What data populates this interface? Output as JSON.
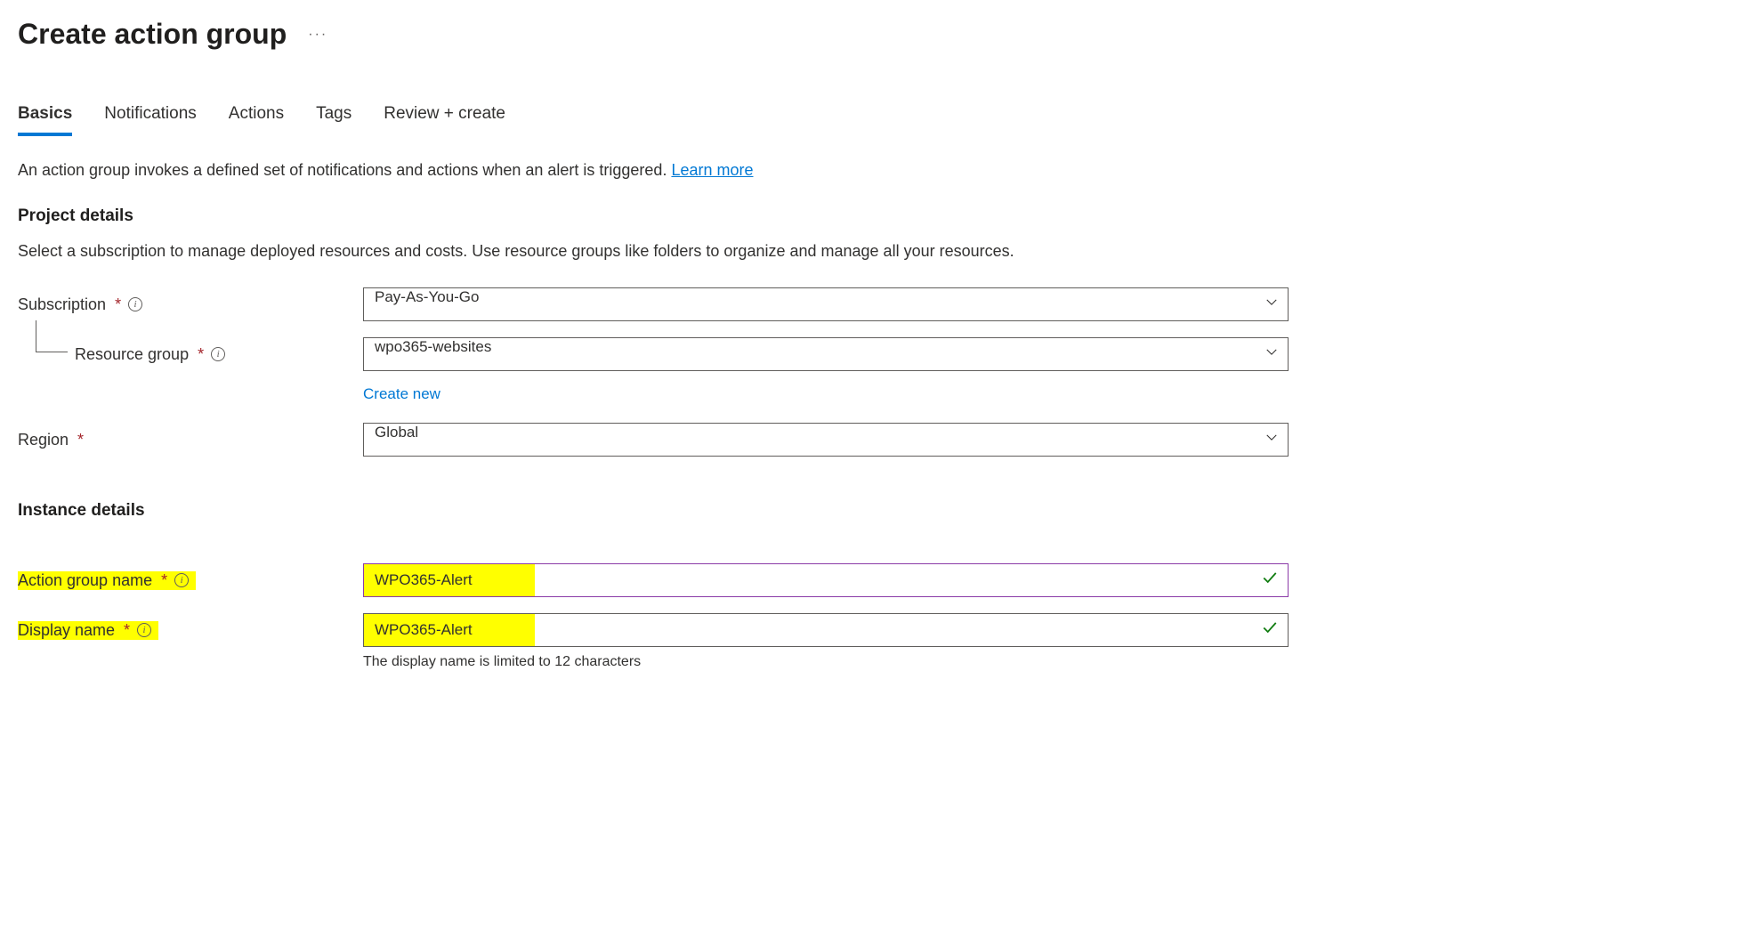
{
  "header": {
    "title": "Create action group"
  },
  "tabs": [
    {
      "label": "Basics",
      "active": true
    },
    {
      "label": "Notifications",
      "active": false
    },
    {
      "label": "Actions",
      "active": false
    },
    {
      "label": "Tags",
      "active": false
    },
    {
      "label": "Review + create",
      "active": false
    }
  ],
  "intro": {
    "text": "An action group invokes a defined set of notifications and actions when an alert is triggered. ",
    "link_text": "Learn more"
  },
  "project_details": {
    "title": "Project details",
    "desc": "Select a subscription to manage deployed resources and costs. Use resource groups like folders to organize and manage all your resources.",
    "subscription_label": "Subscription",
    "subscription_value": "Pay-As-You-Go",
    "resource_group_label": "Resource group",
    "resource_group_value": "wpo365-websites",
    "create_new": "Create new",
    "region_label": "Region",
    "region_value": "Global"
  },
  "instance_details": {
    "title": "Instance details",
    "action_group_label": "Action group name",
    "action_group_value": "WPO365-Alert",
    "display_name_label": "Display name",
    "display_name_value": "WPO365-Alert",
    "display_name_helper": "The display name is limited to 12 characters"
  }
}
